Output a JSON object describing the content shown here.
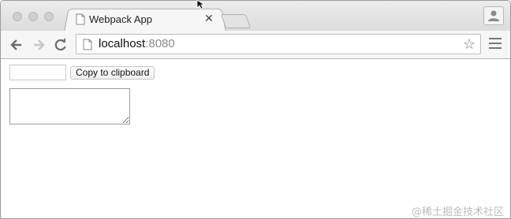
{
  "browser": {
    "tab": {
      "title": "Webpack App"
    },
    "address_bar": {
      "host": "localhost",
      "port": ":8080"
    }
  },
  "page": {
    "text_input": {
      "value": "",
      "placeholder": ""
    },
    "copy_button": {
      "label": "Copy to clipboard"
    },
    "textarea": {
      "value": ""
    }
  },
  "watermark": "@稀土掘金技术社区",
  "icons": [
    "close-icon",
    "back-arrow-icon",
    "forward-arrow-icon",
    "reload-icon",
    "page-icon",
    "star-icon",
    "menu-icon",
    "profile-icon",
    "cursor-icon"
  ],
  "colors": {
    "chrome_bg": "#dcdcdc",
    "toolbar_bg": "#f6f6f6",
    "border": "#b5b5b5"
  }
}
